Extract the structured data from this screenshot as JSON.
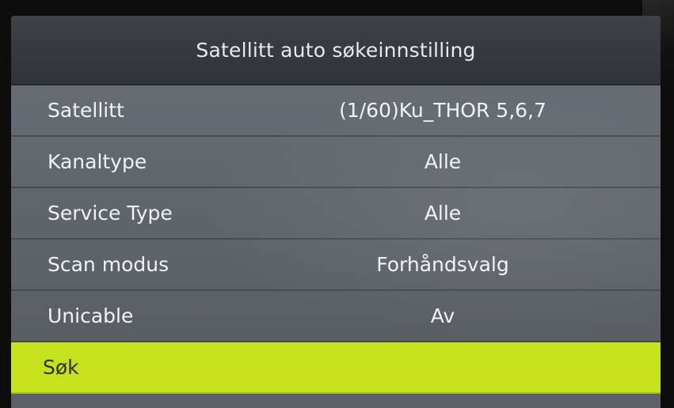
{
  "menu": {
    "title": "Satellitt auto søkeinnstilling",
    "items": [
      {
        "label": "Satellitt",
        "value": "(1/60)Ku_THOR 5,6,7"
      },
      {
        "label": "Kanaltype",
        "value": "Alle"
      },
      {
        "label": "Service Type",
        "value": "Alle"
      },
      {
        "label": "Scan modus",
        "value": "Forhåndsvalg"
      },
      {
        "label": "Unicable",
        "value": "Av"
      },
      {
        "label": "Søk",
        "value": ""
      }
    ],
    "selected_index": 5
  },
  "colors": {
    "selection_highlight": "#c6e21d",
    "menu_background": "#60676d",
    "header_background": "#33393e",
    "text": "#f1f2f3"
  }
}
